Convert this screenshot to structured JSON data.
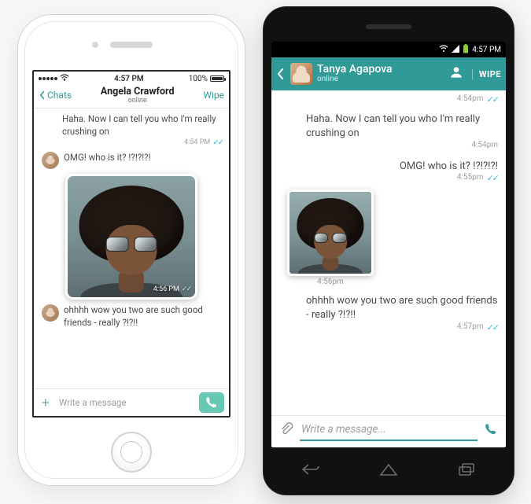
{
  "ios": {
    "status": {
      "carrier_dots": 5,
      "time": "4:57 PM",
      "battery": "100%"
    },
    "header": {
      "back_label": "Chats",
      "name": "Angela Crawford",
      "sub": "online",
      "wipe": "Wipe"
    },
    "messages": {
      "m1_text": "Haha. Now I can tell you who I'm really crushing on",
      "m1_time": "4:54 PM",
      "m2_text": "OMG! who is it? !?!?!?!",
      "img_time": "4:56 PM",
      "m3_text": "ohhhh wow you two are such good friends - really ?!?!!"
    },
    "input": {
      "placeholder": "Write a message"
    }
  },
  "android": {
    "status": {
      "time": "4:57 PM"
    },
    "header": {
      "name": "Tanya Agapova",
      "sub": "online",
      "wipe": "WIPE"
    },
    "messages": {
      "m0_time": "4:54pm",
      "m1_text": "Haha. Now I can tell you who I'm really crushing on",
      "m1_time": "4:54pm",
      "m2_text": "OMG! who is it? !?!?!?!",
      "m2_time": "4:55pm",
      "img_time": "4:56pm",
      "m3_text": "ohhhh wow you two are such good friends - really ?!?!!",
      "m3_time": "4:57pm"
    },
    "input": {
      "placeholder": "Write a message..."
    }
  }
}
